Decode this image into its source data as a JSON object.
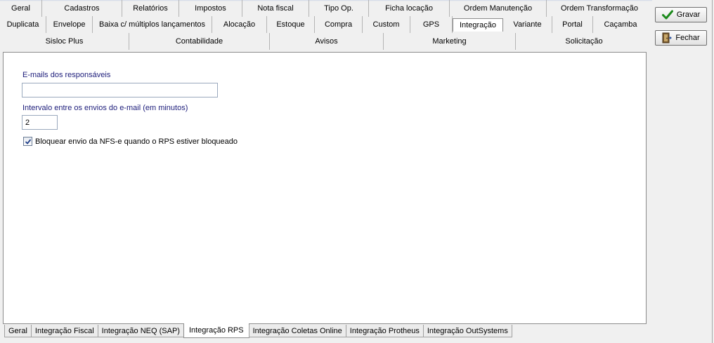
{
  "tabs": {
    "row1": [
      "Geral",
      "Cadastros",
      "Relatórios",
      "Impostos",
      "Nota fiscal",
      "Tipo Op.",
      "Ficha locação",
      "Ordem Manutenção",
      "Ordem Transformação"
    ],
    "row2": [
      "Duplicata",
      "Envelope",
      "Baixa c/ múltiplos lançamentos",
      "Alocação",
      "Estoque",
      "Compra",
      "Custom",
      "GPS",
      "Integração",
      "Variante",
      "Portal",
      "Caçamba"
    ],
    "row3": [
      "Sisloc Plus",
      "Contabilidade",
      "Avisos",
      "Marketing",
      "Solicitação"
    ],
    "selected": "Integração"
  },
  "form": {
    "emails_label": "E-mails dos responsáveis",
    "emails_value": "",
    "interval_label": "Intervalo entre os envios do e-mail (em minutos)",
    "interval_value": "2",
    "block_label": "Bloquear envio da NFS-e quando o RPS estiver bloqueado",
    "block_checked": true
  },
  "buttons": {
    "save": "Gravar",
    "close": "Fechar"
  },
  "bottom_tabs": [
    "Geral",
    "Integração Fiscal",
    "Integração NEQ (SAP)",
    "Integração RPS",
    "Integração Coletas Online",
    "Integração Protheus",
    "Integração OutSystems"
  ],
  "bottom_selected": "Integração RPS",
  "colors": {
    "label_text": "#1c1c7a",
    "check_green": "#1b8a1b",
    "check_mark": "#22418a"
  }
}
